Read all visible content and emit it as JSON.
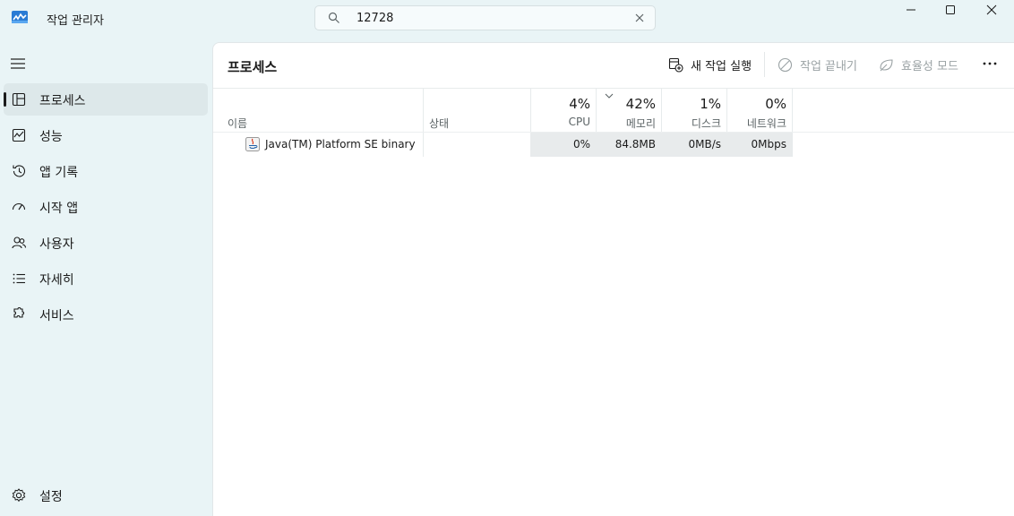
{
  "window": {
    "title": "작업 관리자",
    "controls": {
      "minimize": "minimize-icon",
      "maximize": "maximize-icon",
      "close": "close-icon"
    }
  },
  "search": {
    "value": "12728",
    "placeholder": ""
  },
  "sidebar": {
    "items": [
      {
        "label": "프로세스",
        "icon": "processes-icon",
        "active": true
      },
      {
        "label": "성능",
        "icon": "performance-icon"
      },
      {
        "label": "앱 기록",
        "icon": "app-history-icon"
      },
      {
        "label": "시작 앱",
        "icon": "startup-apps-icon"
      },
      {
        "label": "사용자",
        "icon": "users-icon"
      },
      {
        "label": "자세히",
        "icon": "details-icon"
      },
      {
        "label": "서비스",
        "icon": "services-icon"
      }
    ],
    "settings": {
      "label": "설정",
      "icon": "settings-icon"
    }
  },
  "main": {
    "title": "프로세스",
    "commands": {
      "new_task": "새 작업 실행",
      "end_task": "작업 끝내기",
      "efficiency": "효율성 모드"
    }
  },
  "table": {
    "columns": {
      "name": "이름",
      "status": "상태",
      "cpu": {
        "pct": "4%",
        "label": "CPU"
      },
      "memory": {
        "pct": "42%",
        "label": "메모리"
      },
      "disk": {
        "pct": "1%",
        "label": "디스크"
      },
      "network": {
        "pct": "0%",
        "label": "네트워크"
      }
    },
    "rows": [
      {
        "name": "Java(TM) Platform SE binary",
        "status": "",
        "cpu": "0%",
        "memory": "84.8MB",
        "disk": "0MB/s",
        "network": "0Mbps"
      }
    ]
  },
  "colors": {
    "sidebar_bg": "#e9f4f6",
    "active_bg": "#dde8ea",
    "cell_bg": "#e8ebec"
  }
}
